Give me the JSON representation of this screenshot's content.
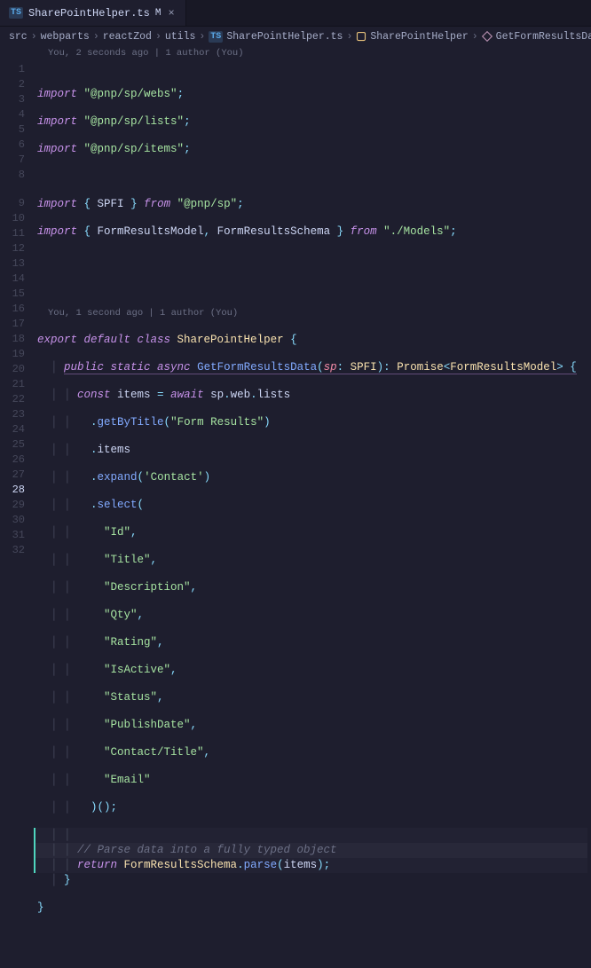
{
  "tab": {
    "icon": "TS",
    "label": "SharePointHelper.ts",
    "modified": "M",
    "close": "×"
  },
  "breadcrumb": {
    "sep": "›",
    "items": [
      "src",
      "webparts",
      "reactZod",
      "utils"
    ],
    "fileIcon": "TS",
    "file": "SharePointHelper.ts",
    "class": "SharePointHelper",
    "method": "GetFormResultsData"
  },
  "codelens": {
    "top": "You, 2 seconds ago | 1 author (You)",
    "class": "You, 1 second ago | 1 author (You)"
  },
  "code": {
    "l1a": "import",
    "l1b": "\"@pnp/sp/webs\"",
    "l1c": ";",
    "l2b": "\"@pnp/sp/lists\"",
    "l3b": "\"@pnp/sp/items\"",
    "l5a": "import",
    "l5b": "{ ",
    "l5c": "SPFI",
    "l5d": " }",
    "l5e": " from ",
    "l5f": "\"@pnp/sp\"",
    "l6b": "FormResultsModel",
    "l6c": ", ",
    "l6d": "FormResultsSchema",
    "l6e": "\"./Models\"",
    "l9a": "export",
    "l9b": " default ",
    "l9c": "class",
    "l9d": " SharePointHelper ",
    "l9e": "{",
    "l10a": "public",
    "l10b": " static ",
    "l10c": "async",
    "l10d": " GetFormResultsData",
    "l10e": "(",
    "l10f": "sp",
    "l10g": ": ",
    "l10h": "SPFI",
    "l10i": ")",
    "l10j": ": ",
    "l10k": "Promise",
    "l10l": "<",
    "l10m": "FormResultsModel",
    "l10n": "> {",
    "l11a": "const",
    "l11b": " items ",
    "l11c": "=",
    "l11d": " await ",
    "l11e": "sp",
    "l11f": ".",
    "l11g": "web",
    "l11h": ".",
    "l11i": "lists",
    "l12a": ".",
    "l12b": "getByTitle",
    "l12c": "(",
    "l12d": "\"Form Results\"",
    "l12e": ")",
    "l13a": ".",
    "l13b": "items",
    "l14a": ".",
    "l14b": "expand",
    "l14c": "(",
    "l14d": "'Contact'",
    "l14e": ")",
    "l15a": ".",
    "l15b": "select",
    "l15c": "(",
    "s16": "\"Id\"",
    "c": ",",
    "s17": "\"Title\"",
    "s18": "\"Description\"",
    "s19": "\"Qty\"",
    "s20": "\"Rating\"",
    "s21": "\"IsActive\"",
    "s22": "\"Status\"",
    "s23": "\"PublishDate\"",
    "s24": "\"Contact/Title\"",
    "s25": "\"Email\"",
    "l26": ")();",
    "l28": "// Parse data into a fully typed object",
    "l29a": "return",
    "l29b": " FormResultsSchema",
    "l29c": ".",
    "l29d": "parse",
    "l29e": "(",
    "l29f": "items",
    "l29g": ");",
    "l30": "}",
    "l31": "}"
  },
  "gutter": [
    "1",
    "2",
    "3",
    "4",
    "5",
    "6",
    "7",
    "8",
    "9",
    "10",
    "11",
    "12",
    "13",
    "14",
    "15",
    "16",
    "17",
    "18",
    "19",
    "20",
    "21",
    "22",
    "23",
    "24",
    "25",
    "26",
    "27",
    "28",
    "29",
    "30",
    "31",
    "32"
  ]
}
